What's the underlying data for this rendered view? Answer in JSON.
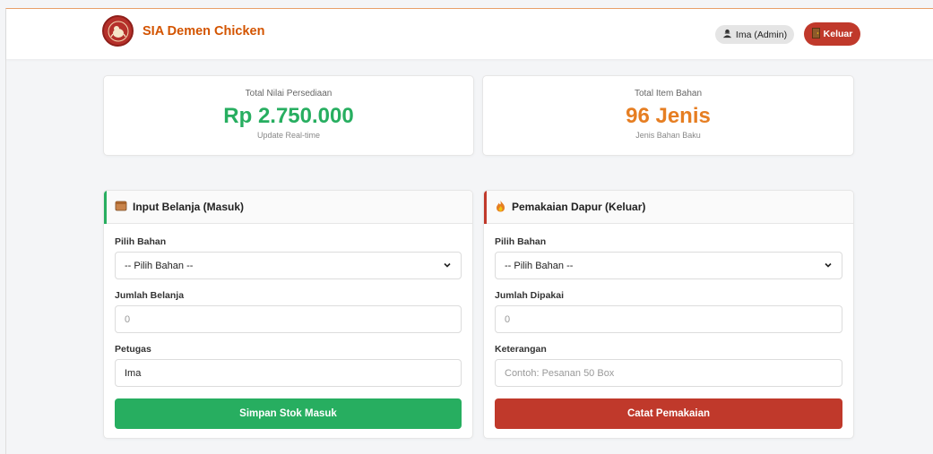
{
  "colors": {
    "brand": "#d35400",
    "green": "#27ae60",
    "orange": "#e67e22",
    "red": "#c0392b"
  },
  "header": {
    "title": "SIA Demen Chicken",
    "user": "Ima (Admin)",
    "logout": "Keluar"
  },
  "stats": {
    "value": {
      "label": "Total Nilai Persediaan",
      "value": "Rp 2.750.000",
      "sub": "Update Real-time"
    },
    "items": {
      "label": "Total Item Bahan",
      "value": "96 Jenis",
      "sub": "Jenis Bahan Baku"
    }
  },
  "purchase": {
    "title": "Input Belanja (Masuk)",
    "bahan_label": "Pilih Bahan",
    "bahan_value": "-- Pilih Bahan --",
    "jumlah_label": "Jumlah Belanja",
    "jumlah_placeholder": "0",
    "petugas_label": "Petugas",
    "petugas_value": "Ima",
    "submit": "Simpan Stok Masuk"
  },
  "usage": {
    "title": "Pemakaian Dapur (Keluar)",
    "bahan_label": "Pilih Bahan",
    "bahan_value": "-- Pilih Bahan --",
    "jumlah_label": "Jumlah Dipakai",
    "jumlah_placeholder": "0",
    "ket_label": "Keterangan",
    "ket_placeholder": "Contoh: Pesanan 50 Box",
    "submit": "Catat Pemakaian"
  }
}
